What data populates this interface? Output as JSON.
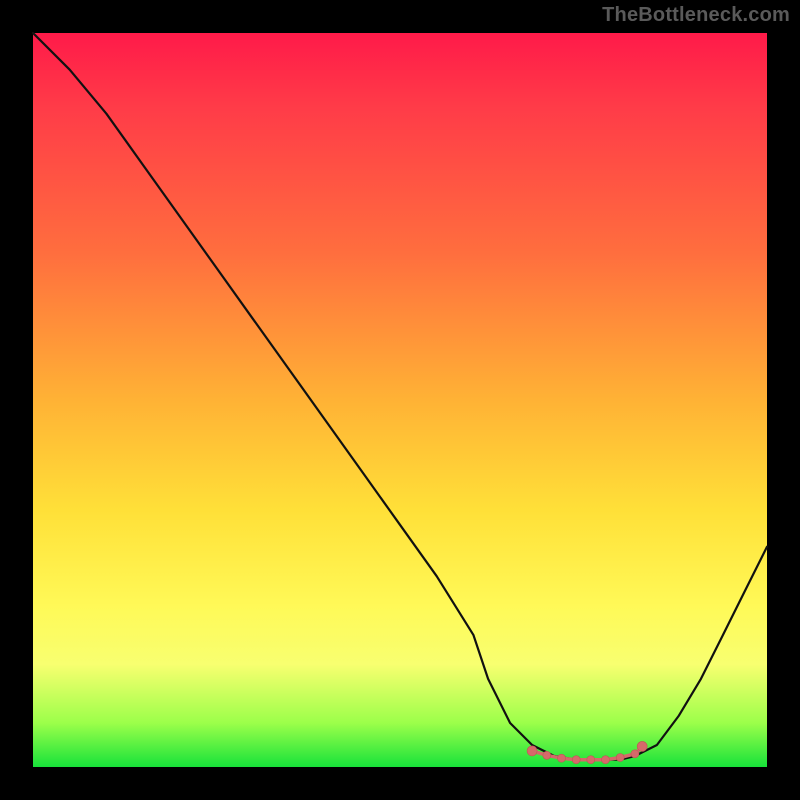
{
  "watermark": "TheBottleneck.com",
  "colors": {
    "gradient_top": "#ff1a49",
    "gradient_bottom": "#17e23a",
    "curve": "#111111",
    "marker": "#d56a6a"
  },
  "chart_data": {
    "type": "line",
    "title": "",
    "xlabel": "",
    "ylabel": "",
    "xlim": [
      0,
      100
    ],
    "ylim": [
      0,
      100
    ],
    "x": [
      0,
      5,
      10,
      15,
      20,
      25,
      30,
      35,
      40,
      45,
      50,
      55,
      60,
      62,
      65,
      68,
      71,
      74,
      77,
      80,
      82,
      85,
      88,
      91,
      94,
      97,
      100
    ],
    "y": [
      100,
      95,
      89,
      82,
      75,
      68,
      61,
      54,
      47,
      40,
      33,
      26,
      18,
      12,
      6,
      3,
      1.5,
      1,
      1,
      1,
      1.5,
      3,
      7,
      12,
      18,
      24,
      30
    ],
    "optimal_range": {
      "x": [
        68,
        70,
        72,
        74,
        76,
        78,
        80,
        82,
        83
      ],
      "y": [
        2.2,
        1.6,
        1.2,
        1.0,
        1.0,
        1.0,
        1.3,
        1.8,
        2.8
      ]
    }
  }
}
